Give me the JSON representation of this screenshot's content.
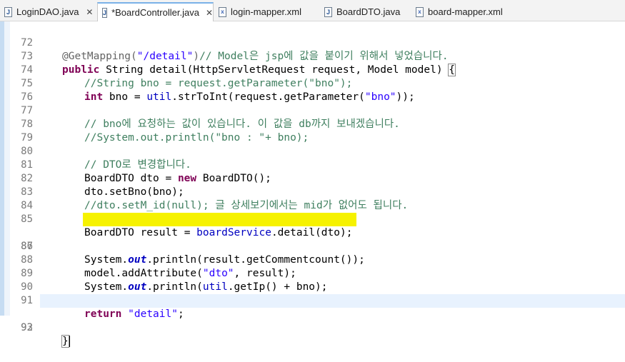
{
  "tabs": [
    {
      "label": "LoginDAO.java",
      "icon": "java-file-icon",
      "active": false,
      "closable": true
    },
    {
      "label": "*BoardController.java",
      "icon": "java-file-icon",
      "active": true,
      "closable": true
    },
    {
      "label": "login-mapper.xml",
      "icon": "xml-file-icon",
      "active": false,
      "closable": false
    },
    {
      "label": "BoardDTO.java",
      "icon": "java-file-icon",
      "active": false,
      "closable": false
    },
    {
      "label": "board-mapper.xml",
      "icon": "xml-file-icon",
      "active": false,
      "closable": false
    }
  ],
  "close_glyph": "✕",
  "editor": {
    "line_numbers": [
      "72",
      "73",
      "74",
      "75",
      "76",
      "77",
      "78",
      "79",
      "80",
      "81",
      "82",
      "83",
      "84",
      "85",
      "86",
      "87",
      "88",
      "89",
      "90",
      "91",
      "92",
      "93"
    ],
    "lines": {
      "l72": {
        "ann": "@GetMapping(",
        "str": "\"/detail\"",
        "rest": ")",
        "cm": "// Model은 jsp에 값을 붙이기 위해서 넣었습니다."
      },
      "l73": {
        "kw1": "public",
        "t1": " String detail(HttpServletRequest ",
        "p1": "request",
        "t2": ", Model ",
        "p2": "model",
        "t3": ") ",
        "brace": "{"
      },
      "l74": {
        "cm": "//String bno = request.getParameter(\"bno\");"
      },
      "l75": {
        "kw": "int",
        "t1": " bno = ",
        "fld": "util",
        "t2": ".strToInt(",
        "p": "request",
        "t3": ".getParameter(",
        "str": "\"bno\"",
        "t4": "));"
      },
      "l77": {
        "cm": "// bno에 요청하는 값이 있습니다. 이 값을 db까지 보내겠습니다."
      },
      "l78": {
        "cm": "//System.out.println(\"bno : \"+ bno);"
      },
      "l80": {
        "cm": "// DTO로 변경합니다."
      },
      "l81": {
        "t1": "BoardDTO dto = ",
        "kw": "new",
        "t2": " BoardDTO();"
      },
      "l82": {
        "t1": "dto.setBno(bno);"
      },
      "l83": {
        "cm": "//dto.setM_id(null); 글 상세보기에서는 mid가 없어도 됩니다."
      },
      "l85": {
        "t1": "BoardDTO ",
        "v": "result",
        "t2": " = ",
        "fld": "boardService",
        "t3": ".detail(dto);"
      },
      "l86": {
        "t1": "System.",
        "sf": "out",
        "t2": ".println(result.getCommentcount());"
      },
      "l88": {
        "p": "model",
        "t1": ".addAttribute(",
        "str": "\"dto\"",
        "t2": ", result);"
      },
      "l89": {
        "t1": "System.",
        "sf": "out",
        "t2": ".println(",
        "fld": "util",
        "t3": ".getIp() + bno);"
      },
      "l91": {
        "kw": "return",
        "sp": " ",
        "str": "\"detail\"",
        "t1": ";"
      },
      "l92": {
        "brace": "}"
      }
    }
  }
}
